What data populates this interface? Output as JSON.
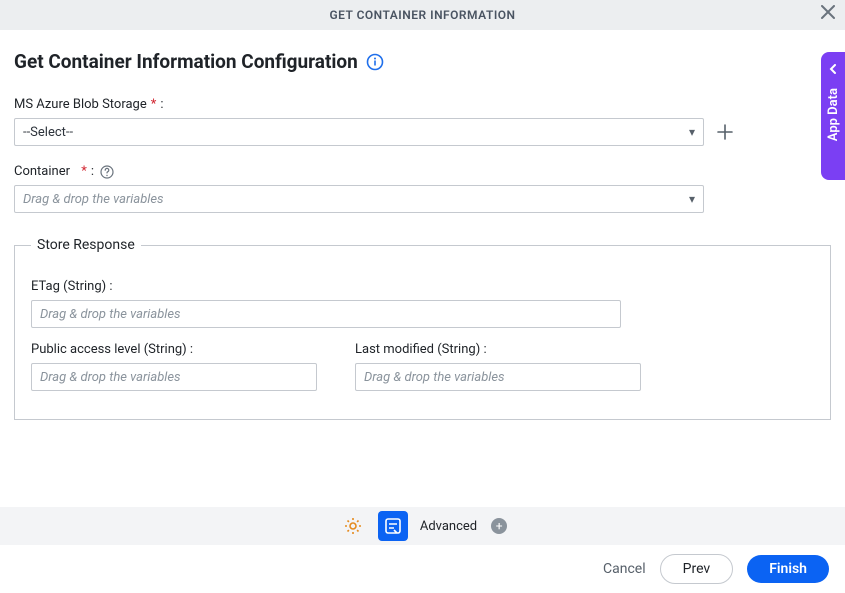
{
  "header": {
    "title": "GET CONTAINER INFORMATION"
  },
  "page": {
    "title": "Get Container Information Configuration"
  },
  "fields": {
    "azure": {
      "label": "MS Azure Blob Storage",
      "colon": ":",
      "selected": "--Select--"
    },
    "container": {
      "label": "Container",
      "colon": " :",
      "placeholder": "Drag & drop the variables"
    }
  },
  "store": {
    "legend": "Store Response",
    "etag": {
      "label": "ETag (String) :",
      "placeholder": "Drag & drop the variables"
    },
    "access": {
      "label": "Public access level (String) :",
      "placeholder": "Drag & drop the variables"
    },
    "modified": {
      "label": "Last modified (String) :",
      "placeholder": "Drag & drop the variables"
    }
  },
  "toolstrip": {
    "advanced": "Advanced"
  },
  "footer": {
    "cancel": "Cancel",
    "prev": "Prev",
    "finish": "Finish"
  },
  "sidepanel": {
    "label": "App Data"
  }
}
